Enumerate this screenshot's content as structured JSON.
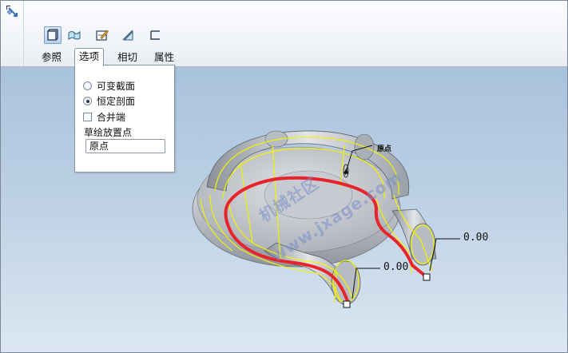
{
  "dashboard": {
    "tools": [
      {
        "name": "reference-tool",
        "icon": "reference-icon",
        "active": true
      },
      {
        "name": "surface-tool",
        "icon": "surface-icon",
        "active": false
      },
      {
        "name": "sketch-tool",
        "icon": "sketch-icon",
        "active": false
      },
      {
        "name": "tangent-tool",
        "icon": "tangent-icon",
        "active": false
      },
      {
        "name": "property-tool",
        "icon": "property-icon",
        "active": false
      }
    ],
    "tabs": [
      {
        "label": "参照"
      },
      {
        "label": "选项"
      },
      {
        "label": "相切"
      },
      {
        "label": "属性"
      }
    ],
    "active_tab": "选项"
  },
  "options_panel": {
    "radio_variable": "可变截面",
    "radio_constant": "恒定剖面",
    "selected": "恒定剖面",
    "merge_ends": "合并端",
    "merge_ends_checked": false,
    "placement_label": "草绘放置点",
    "placement_value": "原点"
  },
  "viewport": {
    "origin_label": "原点",
    "dimension_1": "0.00",
    "dimension_2": "0.00",
    "watermark_cn": "机械社区",
    "watermark_url": "www.jxage.com",
    "colors": {
      "trajectory": "#e8232a",
      "highlight": "#f2f200",
      "model": "#c9cdd2"
    }
  }
}
